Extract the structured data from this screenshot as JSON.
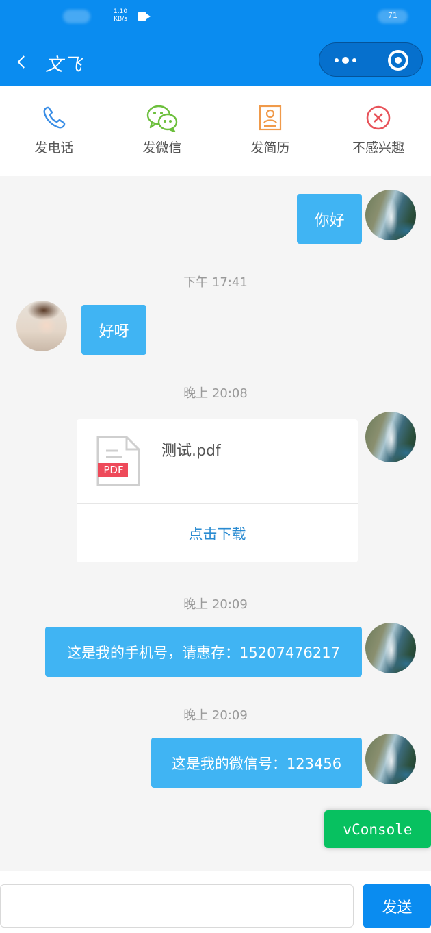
{
  "status_bar": {
    "speed_value": "1.10",
    "speed_unit": "KB/s",
    "battery": "71"
  },
  "nav": {
    "title": "文飞"
  },
  "actions": [
    {
      "label": "发电话",
      "icon": "phone-icon",
      "color": "#3a8ee6"
    },
    {
      "label": "发微信",
      "icon": "wechat-icon",
      "color": "#6cbf3c"
    },
    {
      "label": "发简历",
      "icon": "resume-icon",
      "color": "#f09a4a"
    },
    {
      "label": "不感兴趣",
      "icon": "close-circle-icon",
      "color": "#e8535a"
    }
  ],
  "messages": {
    "msg1": "你好",
    "time1": "下午 17:41",
    "msg2": "好呀",
    "time2": "晚上 20:08",
    "file": {
      "name": "测试.pdf",
      "badge": "PDF",
      "download_label": "点击下载"
    },
    "time3": "晚上 20:09",
    "msg3": "这是我的手机号，请惠存：15207476217",
    "time4": "晚上 20:09",
    "msg4": "这是我的微信号：123456"
  },
  "vconsole_label": "vConsole",
  "input": {
    "value": "",
    "placeholder": "",
    "send_label": "发送"
  },
  "colors": {
    "brand": "#0a8cf0",
    "bubble": "#40b4f3",
    "vconsole": "#07c160",
    "download_link": "#2a8bd1",
    "pdf_badge": "#ee4a5a"
  }
}
